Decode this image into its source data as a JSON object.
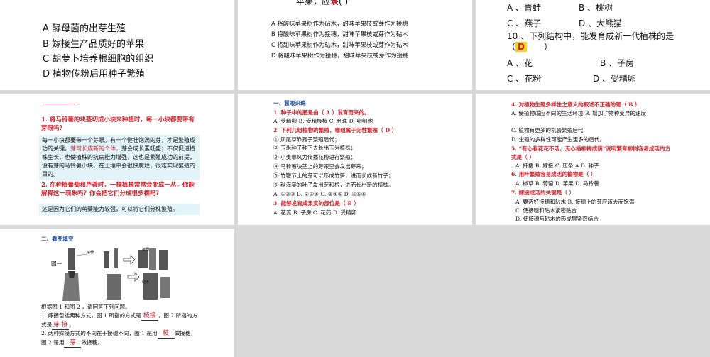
{
  "slide1": {
    "options": [
      "A 酵母菌的出芽生殖",
      "B 嫁接生产品质好的苹果",
      "C 胡萝卜培养根细胞的组织",
      "D 植物传粉后用种子繁殖"
    ]
  },
  "slide2": {
    "top_text": "苹果，应该(  )",
    "answer": "A",
    "options": [
      "A 将酸味苹果树作为砧木，甜味苹果枝或芽作为接穗",
      "B 将酸味苹果树作为接穗，甜味苹果枝或芽作为砧木",
      "C 将甜味苹果树作为砧木，甜味苹果枝或芽作为砧木",
      "D 将酸味苹果树作为接穗，甜味苹果枝或芽作为接穗"
    ]
  },
  "slide3": {
    "row1": [
      "A 、青蛙",
      "B 、桃树"
    ],
    "row2": [
      "C 、燕子",
      "D 、大熊猫"
    ],
    "q10": "10 、下列结构中，能发育成新一代植株的是",
    "q10_paren_open": "（",
    "q10_answer": "D",
    "q10_paren_close": "）",
    "row3": [
      "A 、花",
      "B 、子房"
    ],
    "row4": [
      "C 、花粉",
      "D 、受精卵"
    ]
  },
  "slide4": {
    "q1": "1. 将马铃薯的块茎切成小块来种植时，每一小块都要带有芽眼吗？",
    "a1_part1": "每一小块都要带一个芽眼。有一个健壮饱满的芽，才是繁殖成功的关键。",
    "a1_red": "芽可长成新的个体，",
    "a1_part2": "芽会成长素旺盛；不仅促进植株生长，也使植株的抗病能力增强，这也是繁殖成功的前提，没有芽的马铃薯小块，在土壤中会很快腐烂，很难实现繁殖的目的。",
    "q2": "2. 在种植葡萄和芦荟时，一棵植株常常会变成一丛，你能解释这一现象吗？你会把它们分成很多棵吗？",
    "a2": "这是因为它们的萌蘖能力较强，可以将它们分株繁殖。"
  },
  "slide5": {
    "title": "一、慧眼识珠",
    "q1": "1. 种子中的胚是由（ A ）发育而来的。",
    "q1_opts": "A. 受精卵   B. 受精极核   C. 胚珠   D. 卵细胞",
    "q2": "2. 下列几组植物的繁殖，哪组属于无性繁殖（ D ）",
    "q2_items": [
      "① 凤尾草靠孢子繁殖后代；",
      "② 玉米种子种下去长出玉米植株；",
      "③ 小麦靠风力传播花粉进行繁殖；",
      "④ 马铃薯块茎上的芽眼里会发出芽来；",
      "⑤ 竹鞭节上的芽可以形成竹笋，进而长成新竹子；",
      "⑥ 秋海棠的叶子发出芽和根，进而长出新的植株。"
    ],
    "q2_opts": "A. ①②③   B. ②③④   C. ③④⑤   D. ④⑤⑥",
    "q3": "3. 能够发育成果实的部位是（ B ）",
    "q3_opts": "A. 花蕊   B. 子房   C. 花药   D. 受精卵"
  },
  "slide6": {
    "q4": "4. 对植物生殖多样性之意义的叙述不正确的是（ B ）",
    "q4_opts": [
      "A. 使植物适应不同的生活环境   B. 增加了物种变异的速度",
      "C. 植物有更多的机会繁殖后代",
      "D. 生殖的多样性可能产生更多的后代。"
    ],
    "q5": "5. “有心栽花花不活，无心插柳柳成荫”说明繁育柳树容易成活的方式是（ ）",
    "q5_opts": "A. 扦插   B. 嫁接   C. 压条 A  D. 种子",
    "q6": "6. 用叶繁殖容易成活的植物是（ ）",
    "q6_opts": "A. 椒草   B. 葡萄   D. 苹果   D. 马铃薯",
    "q7": "7. 嫁接成活的关键是（ ）",
    "q7_opts": [
      "A. 要选好接穗和砧木    B. 接穗上的芽应该大而饱满",
      "C. 使接穗和砧木紧密贴合",
      "D. 使接穗与砧木的形成层紧密结合"
    ]
  },
  "slide7": {
    "title": "二、看图填空",
    "fig1_label": "图一",
    "fig_label_top": "接穗",
    "fig_label_bottom": "砧木",
    "intro": "根据图 1 和图 2 ，请回答下列问题。",
    "q1_a": "1. 嫁接包括两种方式，图 1 所指的方式是",
    "q1_ans1": "枝接",
    "q1_b": "，图 2 所指的方式是",
    "q1_ans2": "芽 接",
    "q1_c": "。",
    "q2_a": "2. 两种嫁接方式的不同在于接穗不同，图 1 是用",
    "q2_ans1": "枝",
    "q2_b": "做接穗，图 2 是用",
    "q2_ans2": "芽",
    "q2_c": "做接穗。"
  }
}
